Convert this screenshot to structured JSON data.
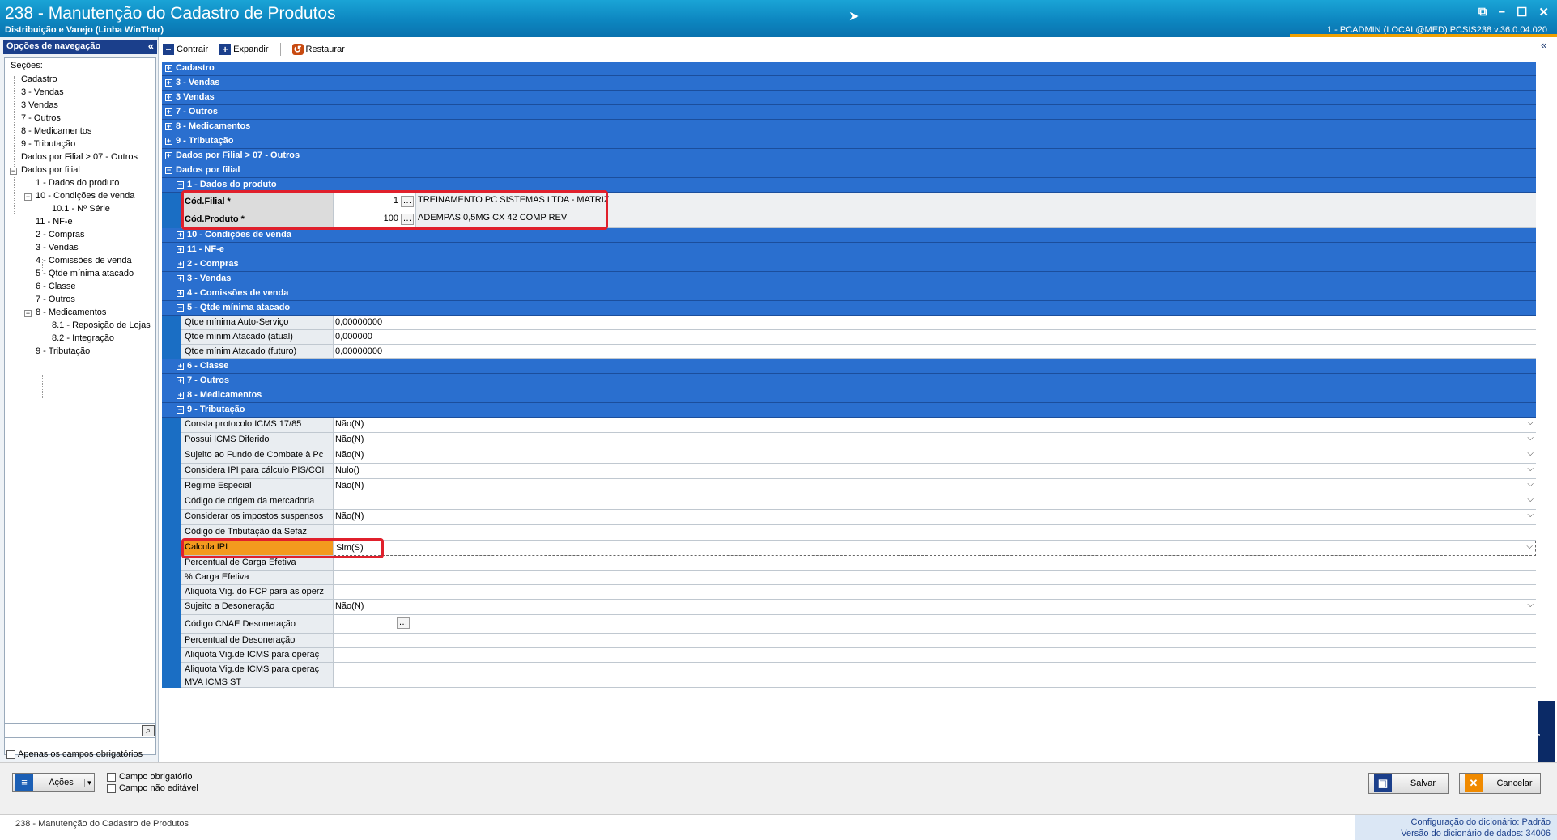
{
  "window": {
    "title": "238 - Manutenção do Cadastro de Produtos",
    "subtitle": "Distribuição e Varejo (Linha WinThor)",
    "user_info": "1 - PCADMIN (LOCAL@MED)   PCSIS238  v.36.0.04.020"
  },
  "nav": {
    "header": "Opções de navegação",
    "sections_label": "Seções:",
    "items": {
      "cadastro": "Cadastro",
      "vendas3": "3 - Vendas",
      "vendas3b": "3 Vendas",
      "outros7": "7 - Outros",
      "medicamentos8": "8 - Medicamentos",
      "tributacao9": "9 - Tributação",
      "dados_filial_07": "Dados por Filial > 07 - Outros",
      "dados_por_filial": "Dados por filial",
      "f_dados_produto": "1 - Dados do produto",
      "f_condicoes": "10 - Condições de venda",
      "f_serie": "10.1 - Nº Série",
      "f_nfe": "11 - NF-e",
      "f_compras": "2 - Compras",
      "f_vendas": "3 - Vendas",
      "f_comissoes": "4 - Comissões de venda",
      "f_qtde": "5 - Qtde mínima atacado",
      "f_classe": "6 - Classe",
      "f_outros": "7 - Outros",
      "f_medicamentos": "8 - Medicamentos",
      "f_reposicao": "8.1 -  Reposição de Lojas",
      "f_integracao": "8.2 - Integração",
      "f_tributacao": "9 - Tributação"
    },
    "only_required_label": "Apenas os campos obrigatórios"
  },
  "toolbar": {
    "collapse": "Contrair",
    "expand": "Expandir",
    "restore": "Restaurar"
  },
  "grid": {
    "groups_top": [
      "Cadastro",
      "3 - Vendas",
      "3 Vendas",
      "7 - Outros",
      "8 - Medicamentos",
      "9 - Tributação",
      "Dados por Filial > 07 - Outros",
      "Dados por filial"
    ],
    "sub_dados_produto": "1 - Dados do produto",
    "cod_filial_label": "Cód.Filial *",
    "cod_filial_value": "1",
    "cod_filial_desc": "TREINAMENTO PC SISTEMAS LTDA - MATRIZ",
    "cod_produto_label": "Cód.Produto *",
    "cod_produto_value": "100",
    "cod_produto_desc": "ADEMPAS 0,5MG CX 42 COMP REV",
    "subs_mid": [
      "10 - Condições de venda",
      "11 - NF-e",
      "2 - Compras",
      "3 - Vendas",
      "4 - Comissões de venda"
    ],
    "sub_qtde": "5 - Qtde mínima atacado",
    "qtde_rows": [
      {
        "label": "Qtde mínima Auto-Serviço",
        "value": "0,00000000"
      },
      {
        "label": "Qtde mínim Atacado (atual)",
        "value": "0,000000"
      },
      {
        "label": "Qtde mínim Atacado (futuro)",
        "value": "0,00000000"
      }
    ],
    "subs_after_qtde": [
      "6 - Classe",
      "7 - Outros",
      "8 - Medicamentos"
    ],
    "sub_tributacao": "9 - Tributação",
    "trib_rows": [
      {
        "label": "Consta protocolo ICMS 17/85",
        "value": "Não(N)"
      },
      {
        "label": "Possui ICMS Diferido",
        "value": "Não(N)"
      },
      {
        "label": "Sujeito ao Fundo de Combate à Pc",
        "value": "Não(N)"
      },
      {
        "label": "Considera IPI para cálculo PIS/COI",
        "value": "Nulo()"
      },
      {
        "label": "Regime Especial",
        "value": "Não(N)"
      },
      {
        "label": "Código de origem da mercadoria",
        "value": ""
      },
      {
        "label": "Considerar os impostos suspensos",
        "value": "Não(N)"
      },
      {
        "label": "Código de Tributação da Sefaz",
        "value": ""
      },
      {
        "label": "Calcula IPI",
        "value": "Sim(S)"
      },
      {
        "label": "Percentual de Carga Efetiva",
        "value": ""
      },
      {
        "label": "% Carga Efetiva",
        "value": ""
      },
      {
        "label": "Aliquota Vig. do FCP para as operz",
        "value": ""
      },
      {
        "label": "Sujeito a Desoneração",
        "value": "Não(N)"
      },
      {
        "label": "Código CNAE Desoneração",
        "value": ""
      },
      {
        "label": "Percentual de Desoneração",
        "value": ""
      },
      {
        "label": "Aliquota Vig.de ICMS para operaç",
        "value": ""
      },
      {
        "label": "Aliquota Vig.de ICMS para operaç",
        "value": ""
      },
      {
        "label": "MVA ICMS ST",
        "value": ""
      }
    ]
  },
  "info_label": "Informação",
  "bottom": {
    "actions": "Ações",
    "legend_required": "Campo obrigatório",
    "legend_noedit": "Campo não editável",
    "save": "Salvar",
    "cancel": "Cancelar"
  },
  "status": {
    "left": "238 - Manutenção do Cadastro de Produtos",
    "dict_config_label": "Configuração do dicionário:",
    "dict_config_value": "Padrão",
    "dict_version_label": "Versão do dicionário de dados:",
    "dict_version_value": "34006"
  },
  "colors": {
    "group_blue": "#2a6fcf",
    "highlight_orange": "#f39a1e",
    "annotation_red": "#e0202c",
    "title_blue": "#0d86c0"
  }
}
